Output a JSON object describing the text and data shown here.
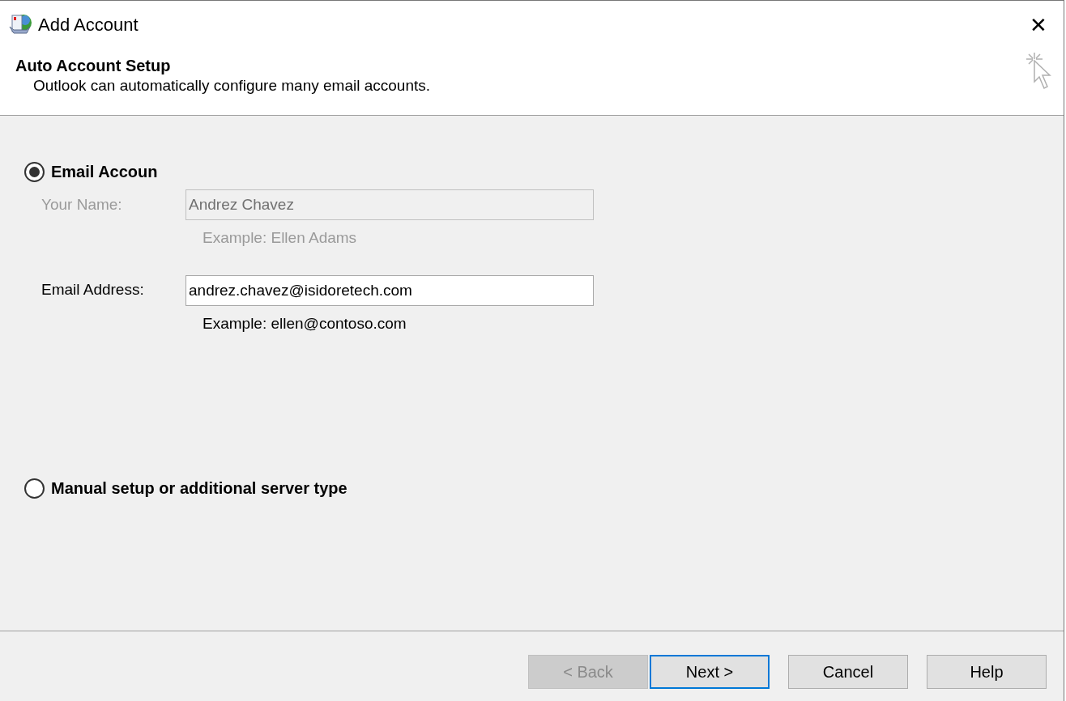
{
  "window": {
    "title": "Add Account",
    "close": "✕"
  },
  "header": {
    "title": "Auto Account Setup",
    "subtitle": "Outlook can automatically configure many email accounts."
  },
  "options": [
    {
      "label": "Email Accoun",
      "selected": true,
      "fields": [
        {
          "label": "Your Name:",
          "value": "Andrez Chavez",
          "example": "Example: Ellen Adams",
          "disabled": true
        },
        {
          "label": "Email Address:",
          "value": "andrez.chavez@isidoretech.com",
          "example": "Example: ellen@contoso.com",
          "disabled": false
        }
      ]
    },
    {
      "label": "Manual setup or additional server type",
      "selected": false
    }
  ],
  "buttons": [
    {
      "label": "< Back",
      "disabled": true,
      "default": false
    },
    {
      "label": "Next >",
      "disabled": false,
      "default": true
    },
    {
      "label": "Cancel",
      "disabled": false,
      "default": false
    },
    {
      "label": "Help",
      "disabled": false,
      "default": false
    }
  ]
}
